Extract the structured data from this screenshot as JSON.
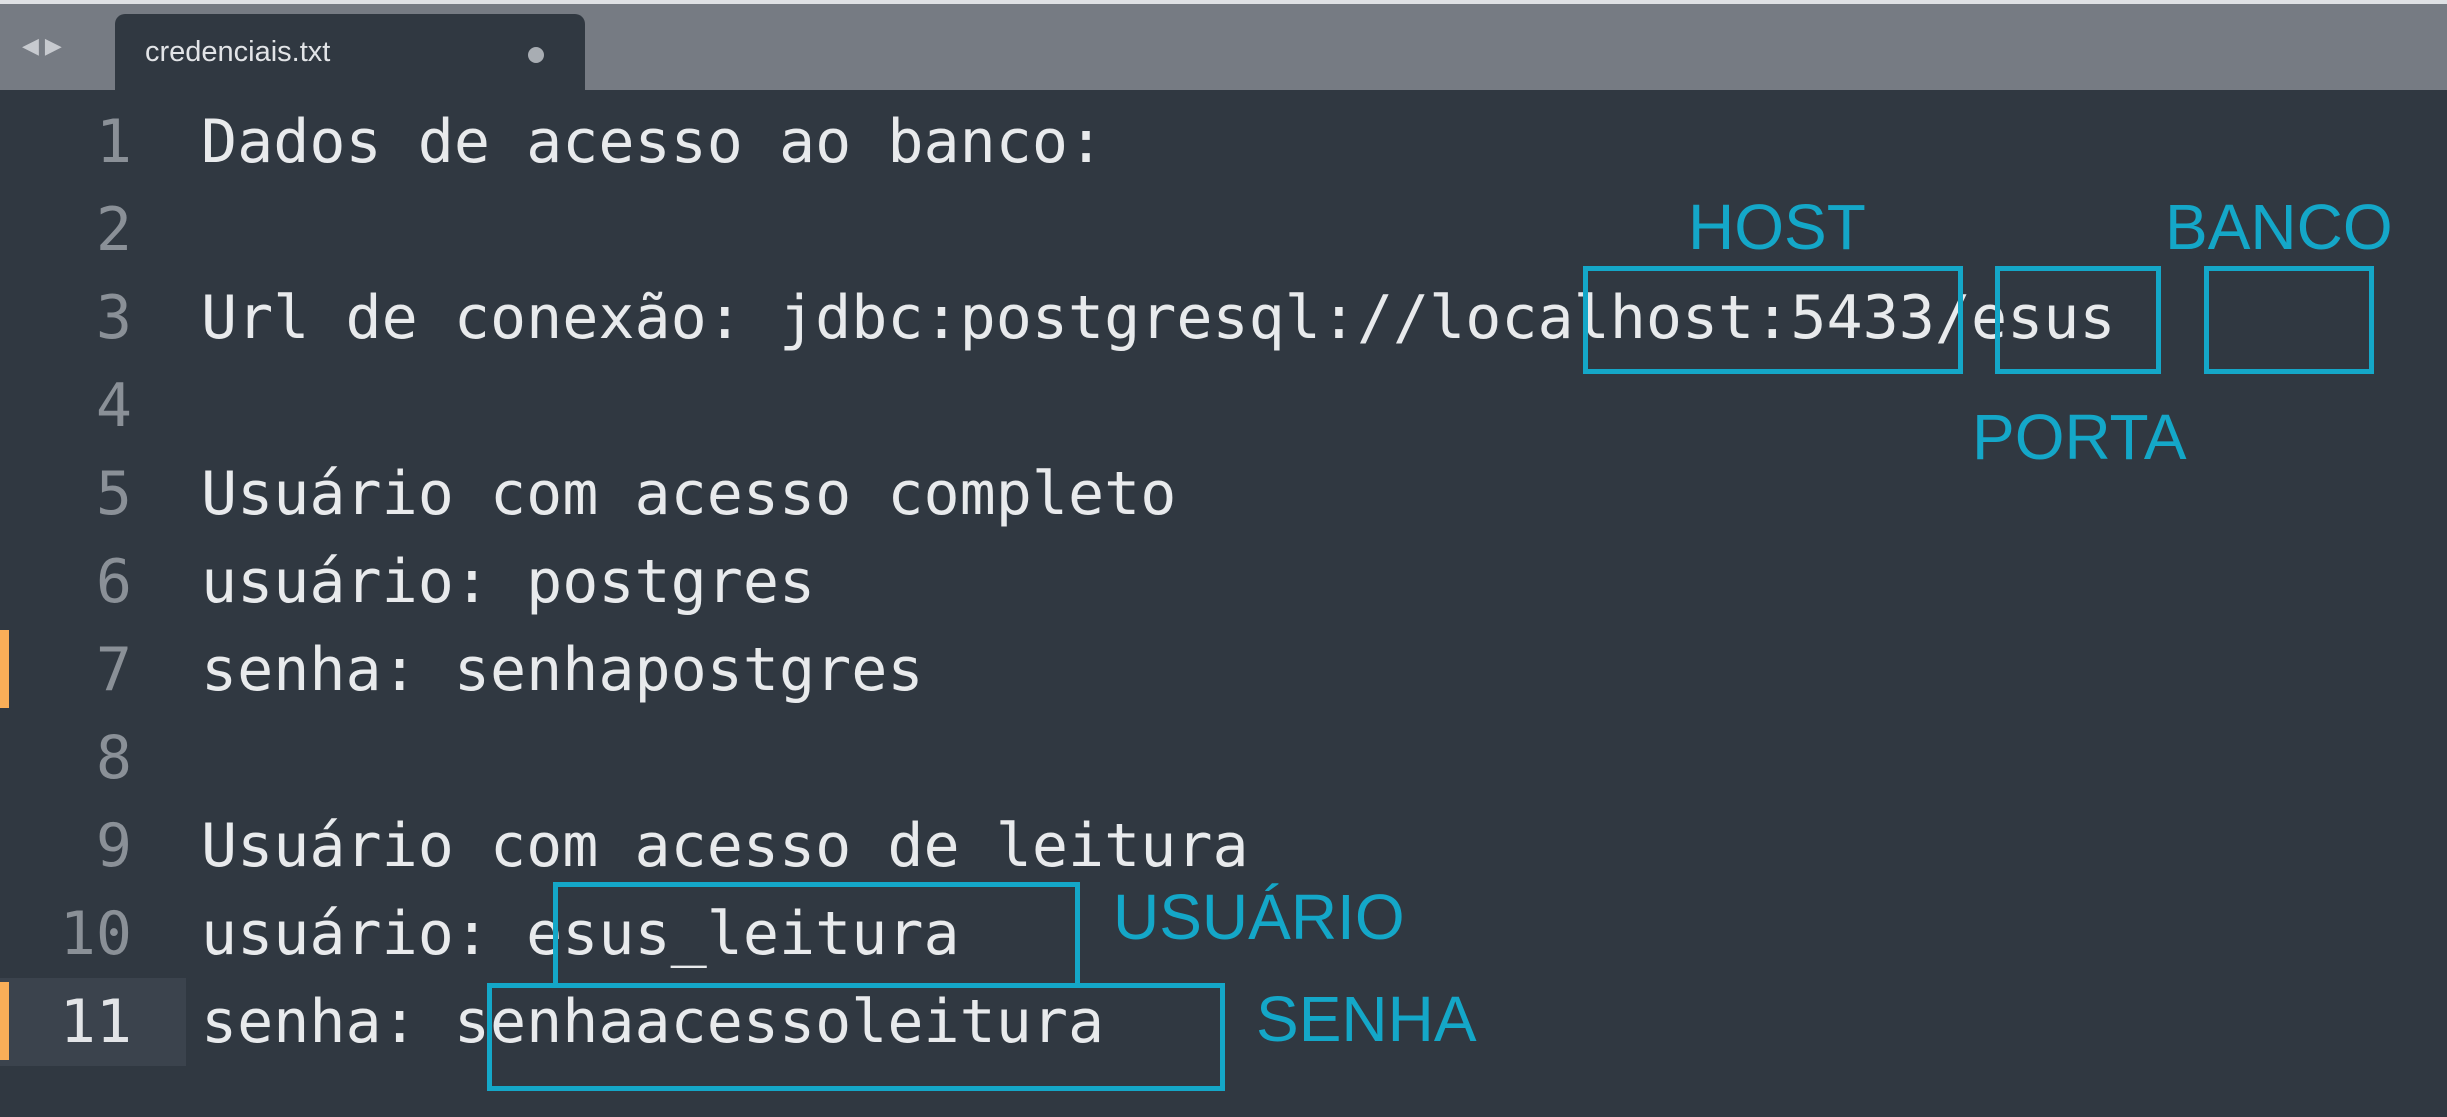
{
  "tabbar": {
    "nav_back": "◀",
    "nav_forward": "▶",
    "tab_title": "credenciais.txt"
  },
  "editor": {
    "lines": [
      {
        "number": "1",
        "text": "Dados de acesso ao banco:"
      },
      {
        "number": "2",
        "text": ""
      },
      {
        "number": "3",
        "text": "Url de conexão: jdbc:postgresql://localhost:5433/esus"
      },
      {
        "number": "4",
        "text": ""
      },
      {
        "number": "5",
        "text": "Usuário com acesso completo"
      },
      {
        "number": "6",
        "text": "usuário: postgres"
      },
      {
        "number": "7",
        "text": "senha: senhapostgres"
      },
      {
        "number": "8",
        "text": ""
      },
      {
        "number": "9",
        "text": "Usuário com acesso de leitura"
      },
      {
        "number": "10",
        "text": "usuário: esus_leitura"
      },
      {
        "number": "11",
        "text": "senha: senhaacessoleitura"
      }
    ]
  },
  "annotations": {
    "host": "HOST",
    "banco": "BANCO",
    "porta": "PORTA",
    "usuario": "USUÁRIO",
    "senha": "SENHA"
  },
  "colors": {
    "editor_bg": "#303841",
    "tabbar_bg": "#767b83",
    "annotation": "#14a7c8",
    "modified_marker": "#f9ae58"
  }
}
